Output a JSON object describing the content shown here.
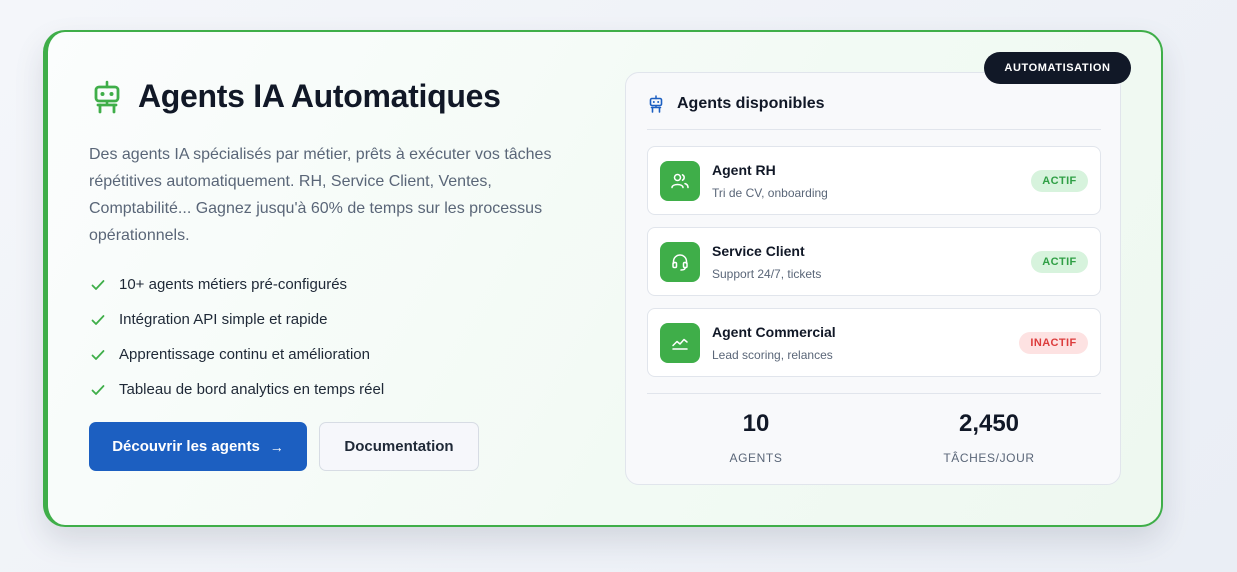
{
  "badge": "AUTOMATISATION",
  "hero": {
    "title": "Agents IA Automatiques",
    "icon": "robot-icon",
    "description": "Des agents IA spécialisés par métier, prêts à exécuter vos tâches répétitives automatiquement. RH, Service Client, Ventes, Comptabilité... Gagnez jusqu'à 60% de temps sur les processus opérationnels.",
    "features": [
      "10+ agents métiers pré-configurés",
      "Intégration API simple et rapide",
      "Apprentissage continu et amélioration",
      "Tableau de bord analytics en temps réel"
    ],
    "primary_button": "Découvrir les agents",
    "primary_button_arrow": "→",
    "secondary_button": "Documentation"
  },
  "panel": {
    "title": "Agents disponibles",
    "agents": [
      {
        "name": "Agent RH",
        "description": "Tri de CV, onboarding",
        "status": "ACTIF",
        "icon": "users-icon"
      },
      {
        "name": "Service Client",
        "description": "Support 24/7, tickets",
        "status": "ACTIF",
        "icon": "headset-icon"
      },
      {
        "name": "Agent Commercial",
        "description": "Lead scoring, relances",
        "status": "INACTIF",
        "icon": "chart-line-icon"
      }
    ],
    "stats": [
      {
        "value": "10",
        "label": "AGENTS"
      },
      {
        "value": "2,450",
        "label": "TÂCHES/JOUR"
      }
    ]
  },
  "colors": {
    "accent_green": "#3fae49",
    "primary_blue": "#1c5fc1",
    "dark": "#111827",
    "active_bg": "#d7f3dd",
    "inactive_bg": "#fde2e2"
  }
}
